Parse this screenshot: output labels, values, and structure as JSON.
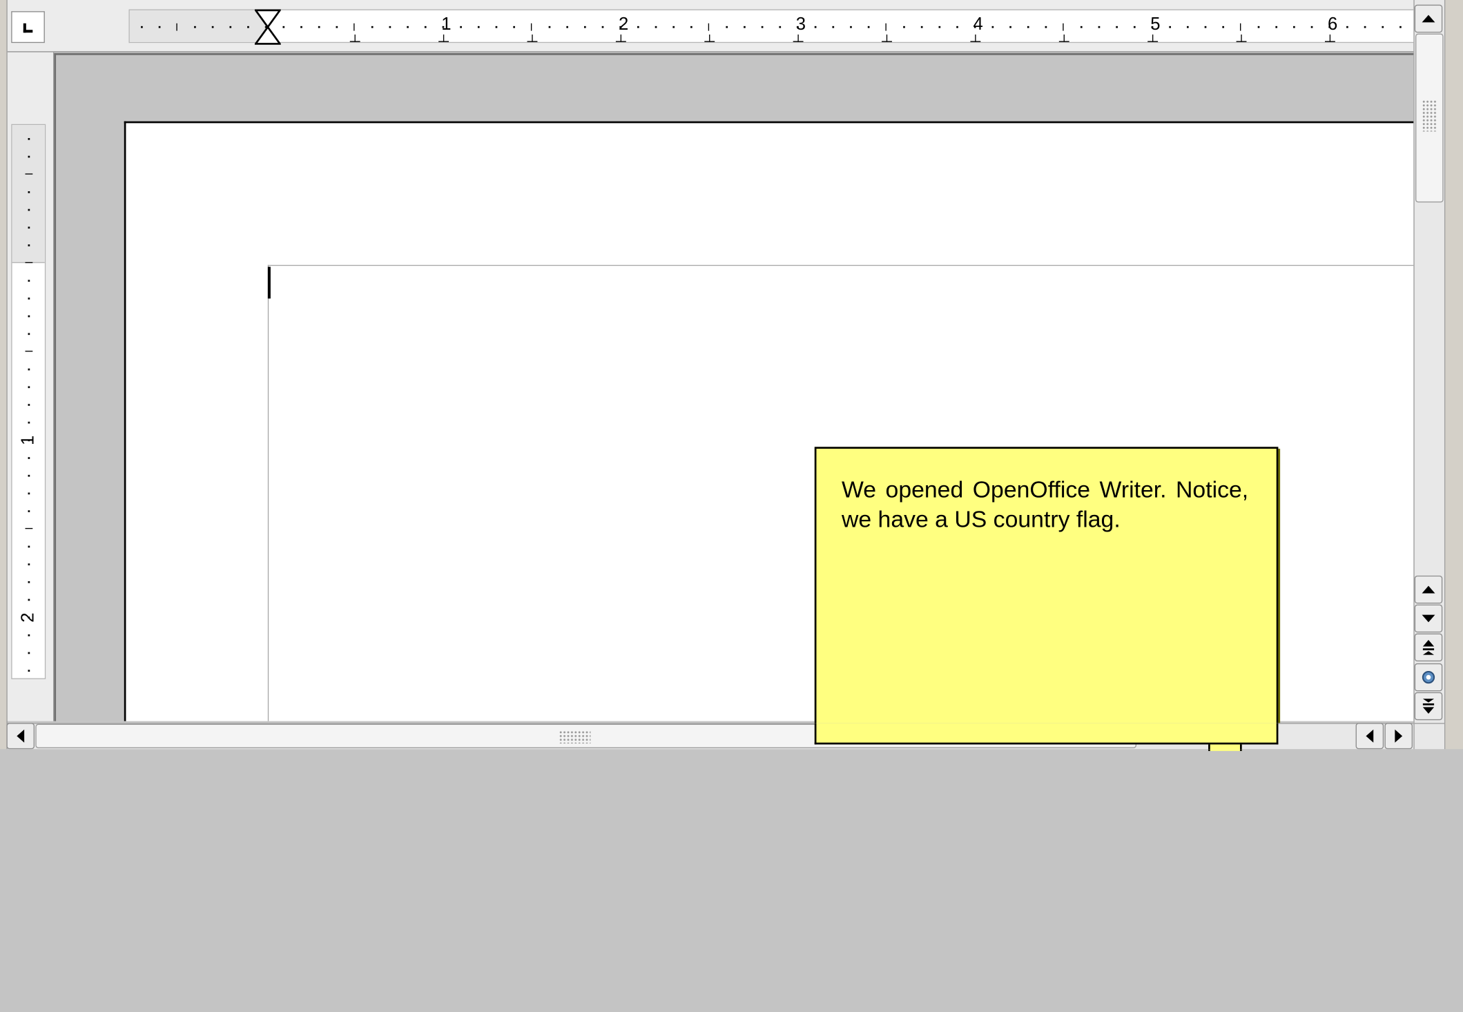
{
  "window": {
    "app": "OpenOffice Writer"
  },
  "horizontal_ruler": {
    "numbers": [
      "1",
      "2",
      "3",
      "4",
      "5",
      "6"
    ],
    "unit": "inch"
  },
  "vertical_ruler": {
    "numbers": [
      "1",
      "2"
    ],
    "unit": "inch"
  },
  "comment": {
    "text": "We opened OpenOffice Writer. Notice, we have a US country flag.",
    "background_color": "#ffff80"
  },
  "icons": {
    "tab_stop": "tab-stop-left-icon",
    "scroll_up": "arrow-up-icon",
    "scroll_down": "arrow-down-icon",
    "scroll_left": "arrow-left-icon",
    "scroll_right": "arrow-right-icon",
    "prev_page": "double-up-icon",
    "next_page": "double-down-icon",
    "navigation": "navigator-icon"
  },
  "colors": {
    "canvas": "#c4c4c4",
    "page": "#ffffff",
    "chrome": "#ececec"
  }
}
